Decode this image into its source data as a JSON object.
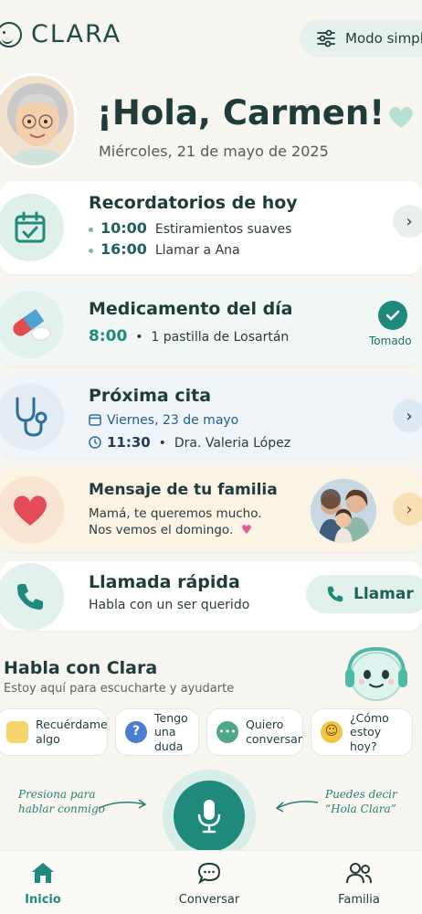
{
  "header": {
    "logo_text": "CLARA",
    "mode_label": "Modo simpl"
  },
  "greeting": {
    "hello": "¡Hola, Carmen!",
    "date": "Miércoles, 21 de mayo de 2025"
  },
  "reminders": {
    "title": "Recordatorios de hoy",
    "items": [
      {
        "time": "10:00",
        "text": "Estiramientos suaves"
      },
      {
        "time": "16:00",
        "text": "Llamar a Ana"
      }
    ]
  },
  "medication": {
    "title": "Medicamento del día",
    "time": "8:00",
    "text": "1 pastilla de Losartán",
    "status": "Tomado"
  },
  "appointment": {
    "title": "Próxima cita",
    "date": "Viernes, 23 de mayo",
    "time": "11:30",
    "doctor": "Dra. Valeria López"
  },
  "family": {
    "title": "Mensaje de tu familia",
    "line1": "Mamá, te queremos mucho.",
    "line2": "Nos vemos el domingo."
  },
  "quick_call": {
    "title": "Llamada rápida",
    "subtitle": "Habla con un ser querido",
    "button": "Llamar"
  },
  "talk": {
    "title": "Habla con Clara",
    "subtitle": "Estoy aquí para escucharte y ayudarte",
    "chips": [
      {
        "l1": "Recuérdame",
        "l2": "algo"
      },
      {
        "l1": "Tengo",
        "l2": "una duda"
      },
      {
        "l1": "Quiero",
        "l2": "conversar"
      },
      {
        "l1": "¿Cómo",
        "l2": "estoy hoy?"
      }
    ]
  },
  "mic": {
    "hint_left_1": "Presiona para",
    "hint_left_2": "hablar conmigo",
    "hint_right_1": "Puedes decir",
    "hint_right_2": "“Hola Clara”"
  },
  "nav": {
    "home": "Inicio",
    "chat": "Conversar",
    "family": "Familia"
  },
  "colors": {
    "accent": "#1f8a7c",
    "teal_light": "#e3f1ec",
    "warm": "#fbf3e4",
    "blue_card": "#eef4f8"
  }
}
